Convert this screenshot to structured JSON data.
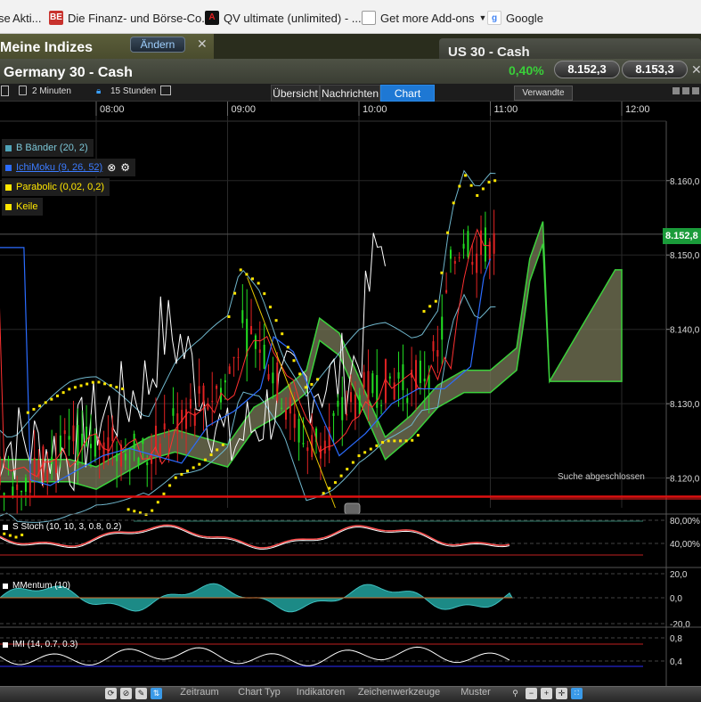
{
  "bookmarks": [
    {
      "label": "se",
      "icon": "page-icon"
    },
    {
      "label": "Akti...",
      "icon": "page-icon"
    },
    {
      "label": "Die Finanz- und Börse-Co...",
      "icon": "be-icon",
      "badge": "BE"
    },
    {
      "label": "QV ultimate (unlimited) - ...",
      "icon": "qv-icon",
      "badge": "A"
    },
    {
      "label": "Get more Add-ons",
      "icon": "page-icon"
    },
    {
      "label": "Google",
      "icon": "google-icon"
    }
  ],
  "panel": {
    "title": "Meine Indizes",
    "edit_label": "Ändern",
    "close": "✕"
  },
  "other_tab": {
    "title": "US 30 - Cash"
  },
  "instrument": {
    "title": "Germany 30 - Cash",
    "change": "0,40%",
    "bid": "8.152,3",
    "ask": "8.153,3",
    "close": "✕"
  },
  "toolbar": {
    "interval": "2 Minuten",
    "range": "15 Stunden",
    "tabs": [
      "Übersicht",
      "Nachrichten",
      "Chart"
    ],
    "active_tab": "Chart",
    "related": "Verwandte"
  },
  "legend": [
    {
      "label": "B Bänder (20, 2)",
      "color": "#4fa3b8"
    },
    {
      "label": "IchiMoku (9, 26, 52)",
      "color": "#2b6cff"
    },
    {
      "label": "Parabolic (0,02, 0,2)",
      "color": "#ffe600"
    },
    {
      "label": "Keile",
      "color": "#ffe600"
    }
  ],
  "last_price_label": "8.152,8",
  "status_text": "Suche abgeschlossen",
  "indicators": [
    {
      "label": "S Stoch (10, 10, 3, 0.8, 0.2)",
      "ticks": [
        "80,00%",
        "40,00%"
      ]
    },
    {
      "label": "MMentum (10)",
      "ticks": [
        "20,0",
        "0,0",
        "-20,0"
      ]
    },
    {
      "label": "IMI (14, 0.7, 0.3)",
      "ticks": [
        "0,8",
        "0,4"
      ]
    }
  ],
  "bottom_menu": [
    "Zeitraum",
    "Chart Typ",
    "Indikatoren",
    "Zeichenwerkzeuge",
    "Muster"
  ],
  "chart_data": {
    "type": "candlestick",
    "title": "Germany 30 - Cash",
    "x_ticks": [
      "08:00",
      "09:00",
      "10:00",
      "11:00",
      "12:00"
    ],
    "y_ticks": [
      "8.160,0",
      "8.150,0",
      "8.140,0",
      "8.130,0",
      "8.120,0"
    ],
    "ylim": [
      8116,
      8168
    ],
    "x_range_hours": [
      7.2,
      12.2
    ],
    "last_price": 8152.8,
    "series_close": [
      [
        7.2,
        8121
      ],
      [
        7.4,
        8120
      ],
      [
        7.6,
        8122
      ],
      [
        7.8,
        8124
      ],
      [
        8.0,
        8125
      ],
      [
        8.2,
        8124
      ],
      [
        8.4,
        8123
      ],
      [
        8.6,
        8128
      ],
      [
        8.8,
        8130
      ],
      [
        9.0,
        8133
      ],
      [
        9.1,
        8140
      ],
      [
        9.25,
        8138
      ],
      [
        9.4,
        8132
      ],
      [
        9.6,
        8124
      ],
      [
        9.8,
        8127
      ],
      [
        10.0,
        8131
      ],
      [
        10.2,
        8133
      ],
      [
        10.4,
        8133
      ],
      [
        10.6,
        8136
      ],
      [
        10.7,
        8148
      ],
      [
        10.8,
        8153
      ],
      [
        10.9,
        8150
      ],
      [
        11.0,
        8152
      ]
    ]
  }
}
